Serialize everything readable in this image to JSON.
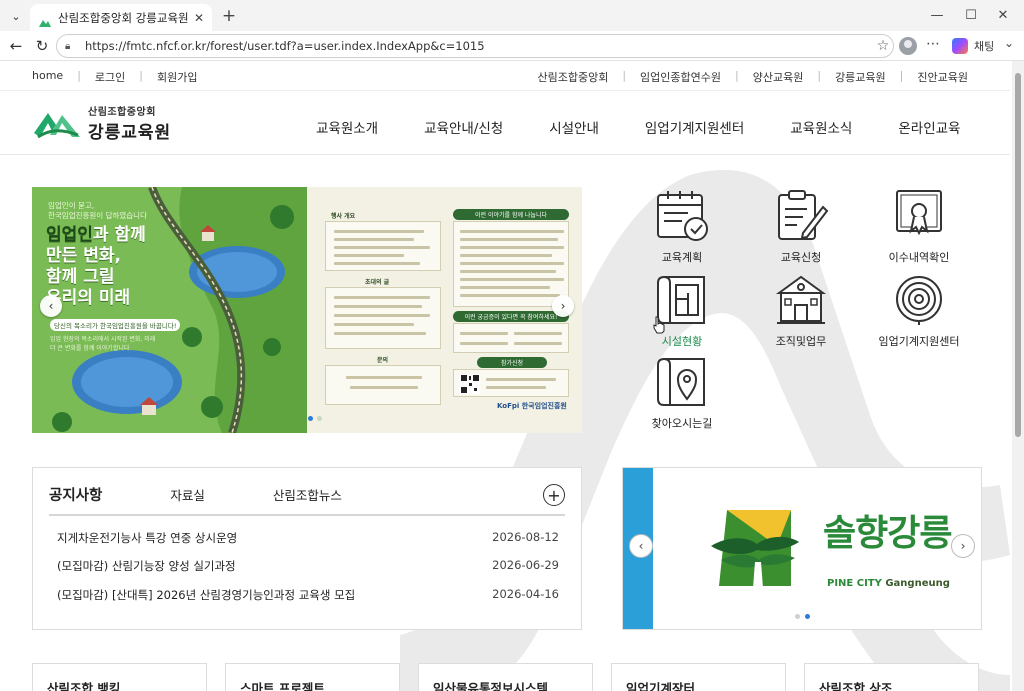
{
  "browser": {
    "tab_title": "산림조합중앙회 강릉교육원",
    "url": "https://fmtc.nfcf.or.kr/forest/user.tdf?a=user.index.IndexApp&c=1015",
    "copilot_label": "채팅"
  },
  "util_nav": {
    "left": [
      "home",
      "로그인",
      "회원가입"
    ],
    "right": [
      "산림조합중앙회",
      "임업인종합연수원",
      "양산교육원",
      "강릉교육원",
      "진안교육원"
    ]
  },
  "logo": {
    "org": "산림조합중앙회",
    "name": "강릉교육원"
  },
  "gnb": [
    "교육원소개",
    "교육안내/신청",
    "시설안내",
    "임업기계지원센터",
    "교육원소식",
    "온라인교육"
  ],
  "banner": {
    "small_text": "임업인이 묻고,\n한국임업진흥원이 답하였습니다",
    "title_hl": "임업인",
    "title_rest_1": "과 함께",
    "title_line_2": "만든 변화,",
    "title_line_3": "함께 그릴",
    "title_line_4": "우리의 미래",
    "tag": "당신의 목소리가 한국임업진흥원을 바꿉니다!",
    "desc": "임업 현장의 목소리에서 시작된 변화, 미래 더 큰 변화를 함께 이야기합니다",
    "right_labels": [
      "행사 개요",
      "초대의 글",
      "문의",
      "이런 이야기를 함께 나눕니다",
      "이런 궁금증이 있다면 꼭 참여하세요!",
      "참가신청"
    ],
    "right_footer": "KoFpi 한국임업진흥원"
  },
  "quick_links": [
    {
      "label": "교육계획",
      "icon": "calendar-check-icon"
    },
    {
      "label": "교육신청",
      "icon": "clipboard-pen-icon"
    },
    {
      "label": "이수내역확인",
      "icon": "certificate-icon"
    },
    {
      "label": "시설현황",
      "icon": "floorplan-icon"
    },
    {
      "label": "조직및업무",
      "icon": "building-icon"
    },
    {
      "label": "임업기계지원센터",
      "icon": "tree-rings-icon"
    },
    {
      "label": "찾아오시는길",
      "icon": "map-pin-icon"
    }
  ],
  "notice": {
    "tabs": [
      "공지사항",
      "자료실",
      "산림조합뉴스"
    ],
    "more": "+",
    "rows": [
      {
        "title": "지게차운전기능사 특강 연중 상시운영",
        "date": "2026-08-12"
      },
      {
        "title": "(모집마감) 산림기능장 양성 실기과정",
        "date": "2026-06-29"
      },
      {
        "title": "(모집마감) [산대특] 2026년 산림경영기능인과정 교육생 모집",
        "date": "2026-04-16"
      }
    ]
  },
  "promo": {
    "title": "솔향강릉",
    "sub_1": "PINE CITY",
    "sub_2": "Gangneung"
  },
  "cards": [
    "산림조합 뱅킹",
    "스마트 프로젝트",
    "임산물유통정보시스템",
    "임업기계장터",
    "산림조합 상조"
  ],
  "colors": {
    "accent_green": "#1e8b4a",
    "promo_blue": "#2a9fd8",
    "slider_dot_active": "#2e7bd6"
  }
}
